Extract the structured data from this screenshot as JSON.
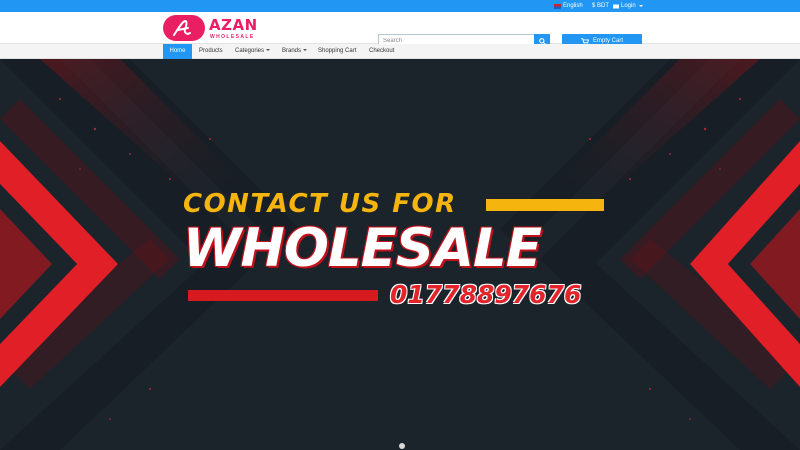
{
  "topbar": {
    "language": "English",
    "currency": "$ BDT",
    "login": "Login"
  },
  "header": {
    "logo_title": "AZAN",
    "logo_subtitle": "WHOLESALE",
    "brand_color": "#e91e63",
    "search_placeholder": "Search",
    "cart_label": "Empty Cart"
  },
  "nav": {
    "items": [
      {
        "label": "Home",
        "active": true
      },
      {
        "label": "Products"
      },
      {
        "label": "Categories",
        "dropdown": true
      },
      {
        "label": "Brands",
        "dropdown": true
      },
      {
        "label": "Shopping Cart"
      },
      {
        "label": "Checkout"
      }
    ]
  },
  "banner": {
    "headline": "CONTACT US FOR",
    "title": "WHOLESALE",
    "phone": "01778897676",
    "accent_yellow": "#f6b40e",
    "accent_red": "#d71920",
    "background": "#1b232b",
    "slide_count": 1
  },
  "colors": {
    "primary": "#2196f3"
  }
}
